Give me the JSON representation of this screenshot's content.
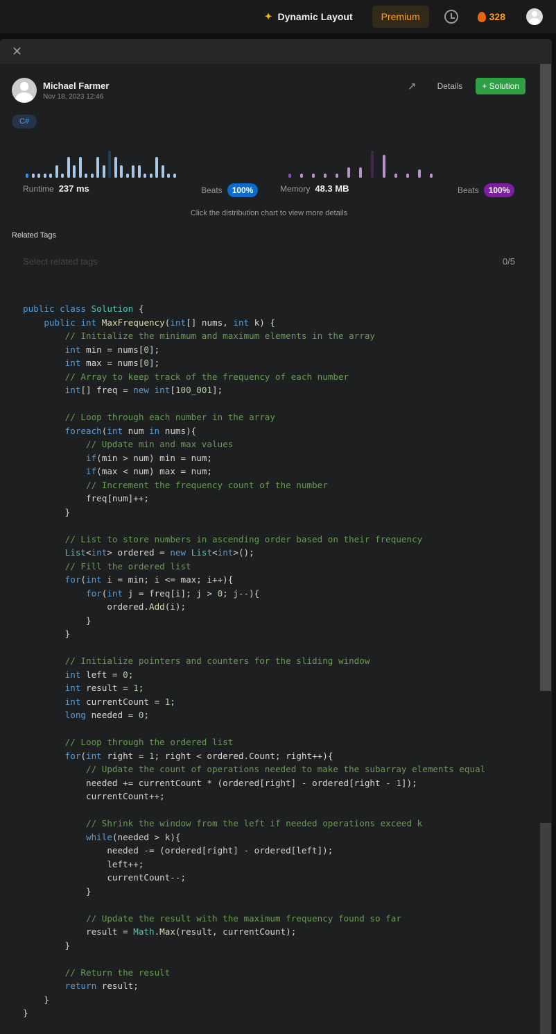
{
  "topbar": {
    "dynamic_layout": "Dynamic Layout",
    "premium": "Premium",
    "streak": "328"
  },
  "author": {
    "name": "Michael Farmer",
    "date": "Nov 18, 2023 12:46"
  },
  "actions": {
    "details": "Details",
    "solution": "Solution"
  },
  "language": "C#",
  "runtime": {
    "label": "Runtime",
    "value": "237 ms",
    "beats_label": "Beats",
    "beats": "100%",
    "color": "#0a84ff"
  },
  "memory": {
    "label": "Memory",
    "value": "48.3 MB",
    "beats_label": "Beats",
    "beats": "100%",
    "color": "#7d1fa0"
  },
  "chart_data": [
    {
      "type": "bar",
      "name": "runtime-distribution",
      "values": [
        1,
        1,
        1,
        1,
        1,
        5,
        1,
        9,
        5,
        9,
        1,
        1,
        9,
        5,
        12,
        9,
        5,
        1,
        5,
        5,
        1,
        1,
        9,
        5,
        1,
        1
      ],
      "highlight_index": 0,
      "dark_index": 14
    },
    {
      "type": "bar",
      "name": "memory-distribution",
      "values": [
        1,
        1,
        1,
        1,
        1,
        4,
        4,
        12,
        10,
        1,
        1,
        3,
        1
      ],
      "highlight_index": 0,
      "dark_index": 7
    }
  ],
  "hint": "Click the distribution chart to view more details",
  "related_tags": {
    "label": "Related Tags",
    "placeholder": "Select related tags",
    "count": "0/5"
  },
  "code": [
    "public class Solution {",
    "    public int MaxFrequency(int[] nums, int k) {",
    "        // Initialize the minimum and maximum elements in the array",
    "        int min = nums[0];",
    "        int max = nums[0];",
    "        // Array to keep track of the frequency of each number",
    "        int[] freq = new int[100_001];",
    "",
    "        // Loop through each number in the array",
    "        foreach(int num in nums){",
    "            // Update min and max values",
    "            if(min > num) min = num;",
    "            if(max < num) max = num;",
    "            // Increment the frequency count of the number",
    "            freq[num]++;",
    "        }",
    "",
    "        // List to store numbers in ascending order based on their frequency",
    "        List<int> ordered = new List<int>();",
    "        // Fill the ordered list",
    "        for(int i = min; i <= max; i++){",
    "            for(int j = freq[i]; j > 0; j--){",
    "                ordered.Add(i);",
    "            }",
    "        }",
    "",
    "        // Initialize pointers and counters for the sliding window",
    "        int left = 0;",
    "        int result = 1;",
    "        int currentCount = 1;",
    "        long needed = 0;",
    "",
    "        // Loop through the ordered list",
    "        for(int right = 1; right < ordered.Count; right++){",
    "            // Update the count of operations needed to make the subarray elements equal",
    "            needed += currentCount * (ordered[right] - ordered[right - 1]);",
    "            currentCount++;",
    "",
    "            // Shrink the window from the left if needed operations exceed k",
    "            while(needed > k){",
    "                needed -= (ordered[right] - ordered[left]);",
    "                left++;",
    "                currentCount--;",
    "            }",
    "",
    "            // Update the result with the maximum frequency found so far",
    "            result = Math.Max(result, currentCount);",
    "        }",
    "",
    "        // Return the result",
    "        return result;",
    "    }",
    "}"
  ]
}
